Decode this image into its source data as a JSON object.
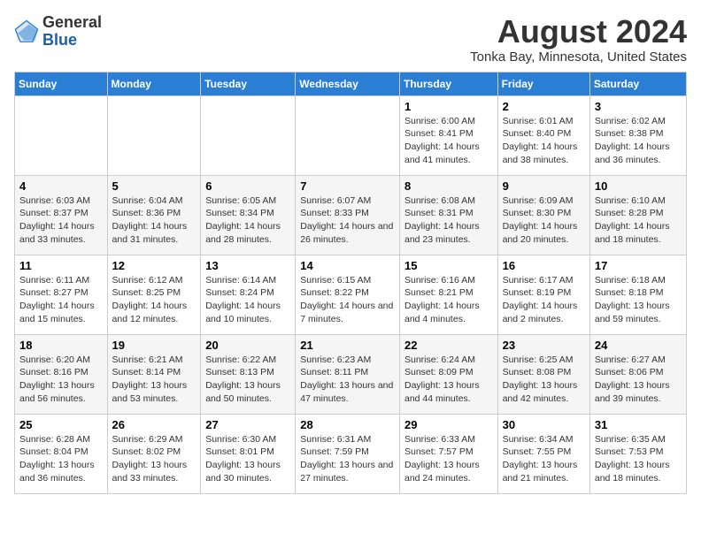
{
  "header": {
    "logo_line1": "General",
    "logo_line2": "Blue",
    "month_year": "August 2024",
    "location": "Tonka Bay, Minnesota, United States"
  },
  "calendar": {
    "days_of_week": [
      "Sunday",
      "Monday",
      "Tuesday",
      "Wednesday",
      "Thursday",
      "Friday",
      "Saturday"
    ],
    "weeks": [
      [
        {
          "day": "",
          "content": ""
        },
        {
          "day": "",
          "content": ""
        },
        {
          "day": "",
          "content": ""
        },
        {
          "day": "",
          "content": ""
        },
        {
          "day": "1",
          "content": "Sunrise: 6:00 AM\nSunset: 8:41 PM\nDaylight: 14 hours and 41 minutes."
        },
        {
          "day": "2",
          "content": "Sunrise: 6:01 AM\nSunset: 8:40 PM\nDaylight: 14 hours and 38 minutes."
        },
        {
          "day": "3",
          "content": "Sunrise: 6:02 AM\nSunset: 8:38 PM\nDaylight: 14 hours and 36 minutes."
        }
      ],
      [
        {
          "day": "4",
          "content": "Sunrise: 6:03 AM\nSunset: 8:37 PM\nDaylight: 14 hours and 33 minutes."
        },
        {
          "day": "5",
          "content": "Sunrise: 6:04 AM\nSunset: 8:36 PM\nDaylight: 14 hours and 31 minutes."
        },
        {
          "day": "6",
          "content": "Sunrise: 6:05 AM\nSunset: 8:34 PM\nDaylight: 14 hours and 28 minutes."
        },
        {
          "day": "7",
          "content": "Sunrise: 6:07 AM\nSunset: 8:33 PM\nDaylight: 14 hours and 26 minutes."
        },
        {
          "day": "8",
          "content": "Sunrise: 6:08 AM\nSunset: 8:31 PM\nDaylight: 14 hours and 23 minutes."
        },
        {
          "day": "9",
          "content": "Sunrise: 6:09 AM\nSunset: 8:30 PM\nDaylight: 14 hours and 20 minutes."
        },
        {
          "day": "10",
          "content": "Sunrise: 6:10 AM\nSunset: 8:28 PM\nDaylight: 14 hours and 18 minutes."
        }
      ],
      [
        {
          "day": "11",
          "content": "Sunrise: 6:11 AM\nSunset: 8:27 PM\nDaylight: 14 hours and 15 minutes."
        },
        {
          "day": "12",
          "content": "Sunrise: 6:12 AM\nSunset: 8:25 PM\nDaylight: 14 hours and 12 minutes."
        },
        {
          "day": "13",
          "content": "Sunrise: 6:14 AM\nSunset: 8:24 PM\nDaylight: 14 hours and 10 minutes."
        },
        {
          "day": "14",
          "content": "Sunrise: 6:15 AM\nSunset: 8:22 PM\nDaylight: 14 hours and 7 minutes."
        },
        {
          "day": "15",
          "content": "Sunrise: 6:16 AM\nSunset: 8:21 PM\nDaylight: 14 hours and 4 minutes."
        },
        {
          "day": "16",
          "content": "Sunrise: 6:17 AM\nSunset: 8:19 PM\nDaylight: 14 hours and 2 minutes."
        },
        {
          "day": "17",
          "content": "Sunrise: 6:18 AM\nSunset: 8:18 PM\nDaylight: 13 hours and 59 minutes."
        }
      ],
      [
        {
          "day": "18",
          "content": "Sunrise: 6:20 AM\nSunset: 8:16 PM\nDaylight: 13 hours and 56 minutes."
        },
        {
          "day": "19",
          "content": "Sunrise: 6:21 AM\nSunset: 8:14 PM\nDaylight: 13 hours and 53 minutes."
        },
        {
          "day": "20",
          "content": "Sunrise: 6:22 AM\nSunset: 8:13 PM\nDaylight: 13 hours and 50 minutes."
        },
        {
          "day": "21",
          "content": "Sunrise: 6:23 AM\nSunset: 8:11 PM\nDaylight: 13 hours and 47 minutes."
        },
        {
          "day": "22",
          "content": "Sunrise: 6:24 AM\nSunset: 8:09 PM\nDaylight: 13 hours and 44 minutes."
        },
        {
          "day": "23",
          "content": "Sunrise: 6:25 AM\nSunset: 8:08 PM\nDaylight: 13 hours and 42 minutes."
        },
        {
          "day": "24",
          "content": "Sunrise: 6:27 AM\nSunset: 8:06 PM\nDaylight: 13 hours and 39 minutes."
        }
      ],
      [
        {
          "day": "25",
          "content": "Sunrise: 6:28 AM\nSunset: 8:04 PM\nDaylight: 13 hours and 36 minutes."
        },
        {
          "day": "26",
          "content": "Sunrise: 6:29 AM\nSunset: 8:02 PM\nDaylight: 13 hours and 33 minutes."
        },
        {
          "day": "27",
          "content": "Sunrise: 6:30 AM\nSunset: 8:01 PM\nDaylight: 13 hours and 30 minutes."
        },
        {
          "day": "28",
          "content": "Sunrise: 6:31 AM\nSunset: 7:59 PM\nDaylight: 13 hours and 27 minutes."
        },
        {
          "day": "29",
          "content": "Sunrise: 6:33 AM\nSunset: 7:57 PM\nDaylight: 13 hours and 24 minutes."
        },
        {
          "day": "30",
          "content": "Sunrise: 6:34 AM\nSunset: 7:55 PM\nDaylight: 13 hours and 21 minutes."
        },
        {
          "day": "31",
          "content": "Sunrise: 6:35 AM\nSunset: 7:53 PM\nDaylight: 13 hours and 18 minutes."
        }
      ]
    ]
  }
}
